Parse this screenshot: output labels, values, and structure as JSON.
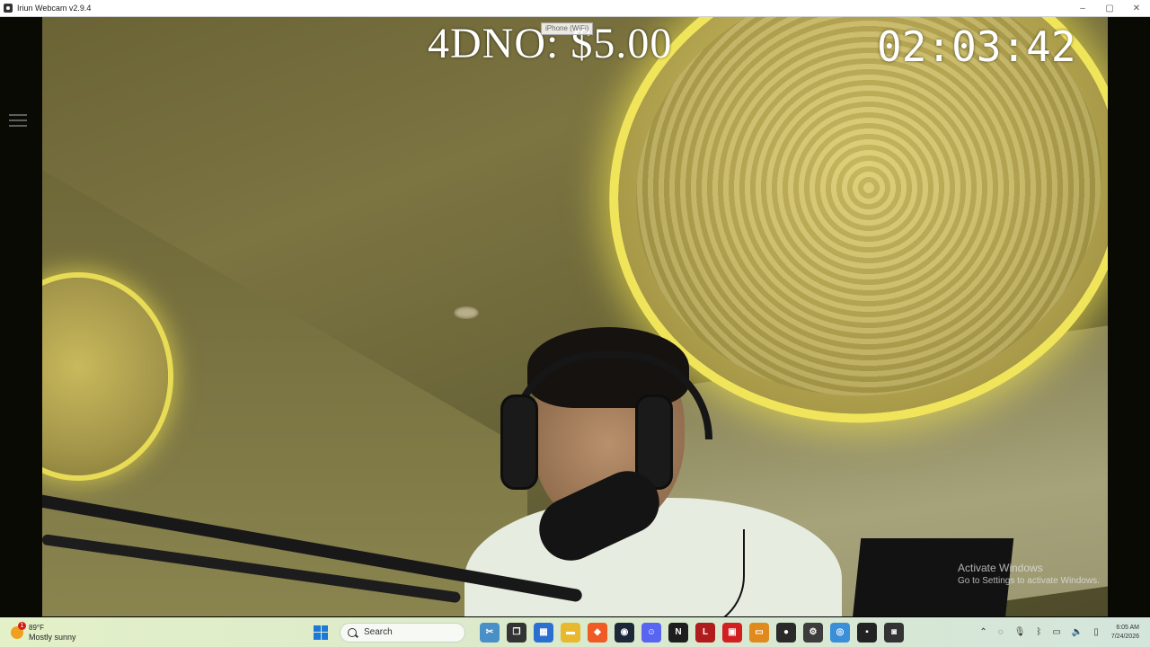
{
  "window": {
    "title": "Iriun Webcam v2.9.4",
    "controls": [
      "–",
      "▢",
      "✕"
    ]
  },
  "overlay": {
    "donation_text": "4DNO: $5.00",
    "tooltip": "iPhone (WiFi)",
    "timer": "02:03:42"
  },
  "watermark": {
    "title": "Activate Windows",
    "subtitle": "Go to Settings to activate Windows."
  },
  "taskbar": {
    "weather": {
      "badge": "1",
      "temp": "89°F",
      "condition": "Mostly sunny"
    },
    "search_label": "Search",
    "apps": [
      {
        "name": "snipping-tool-icon",
        "glyph": "✂",
        "color": "#4a90c8"
      },
      {
        "name": "task-view-icon",
        "glyph": "❐",
        "color": "#333333"
      },
      {
        "name": "store-icon",
        "glyph": "▦",
        "color": "#2b6fd1"
      },
      {
        "name": "file-explorer-icon",
        "glyph": "▬",
        "color": "#e8b92d"
      },
      {
        "name": "brave-icon",
        "glyph": "◆",
        "color": "#f05a24"
      },
      {
        "name": "steam-icon",
        "glyph": "◉",
        "color": "#1b2838"
      },
      {
        "name": "discord-icon",
        "glyph": "☺",
        "color": "#5865f2"
      },
      {
        "name": "nvidia-icon",
        "glyph": "N",
        "color": "#1e1e1e"
      },
      {
        "name": "app-red-icon",
        "glyph": "L",
        "color": "#b01c1c"
      },
      {
        "name": "roblox-studio-icon",
        "glyph": "▣",
        "color": "#d21f1f"
      },
      {
        "name": "app-orange-icon",
        "glyph": "▭",
        "color": "#e08a1e"
      },
      {
        "name": "obs-icon",
        "glyph": "●",
        "color": "#2a2a2a"
      },
      {
        "name": "settings-gear-icon",
        "glyph": "⚙",
        "color": "#3c3c3c"
      },
      {
        "name": "iriun-webcam-icon",
        "glyph": "◎",
        "color": "#3a8fd8"
      },
      {
        "name": "app-dark-icon",
        "glyph": "▪",
        "color": "#222222"
      },
      {
        "name": "camera-app-icon",
        "glyph": "◙",
        "color": "#333333"
      }
    ],
    "tray_icons": [
      "chevron-up-icon",
      "network-icon",
      "microphone-icon",
      "bluetooth-icon",
      "display-icon",
      "speaker-icon",
      "battery-icon"
    ],
    "tray_glyphs": [
      "⌃",
      "◌",
      "🎙",
      "ᛒ",
      "▭",
      "🔈",
      "▯"
    ],
    "clock_time": "6:05 AM",
    "clock_date": "7/24/2026"
  },
  "colors": {
    "accent": "#1e78d7",
    "overlay_text": "#ffffff"
  }
}
